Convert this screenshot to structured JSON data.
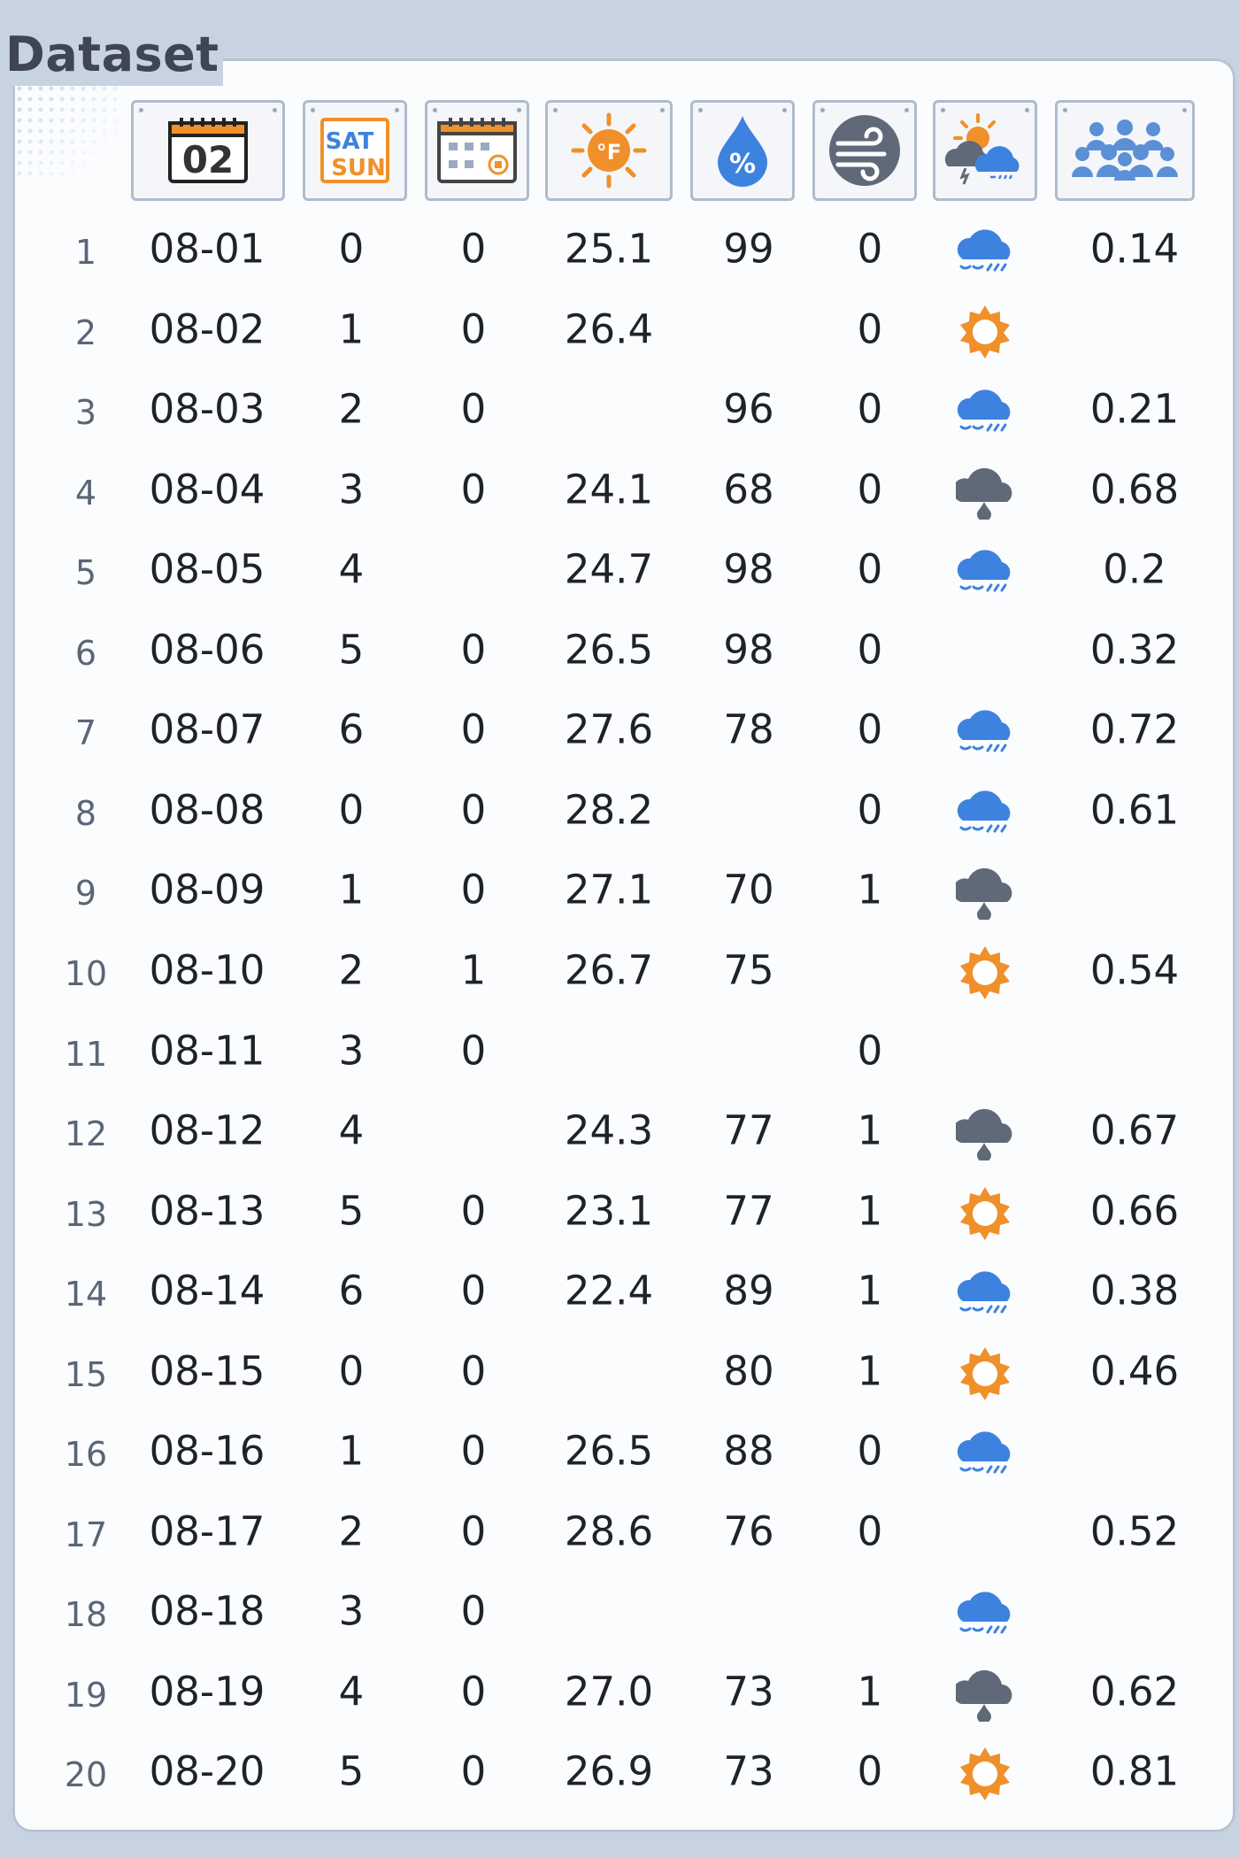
{
  "title": "Dataset",
  "columns": [
    {
      "key": "date",
      "icon": "calendar-date-icon",
      "icon_text": "02"
    },
    {
      "key": "weekday",
      "icon": "weekday-sat-sun-icon",
      "icon_text_1": "SAT",
      "icon_text_2": "SUN"
    },
    {
      "key": "holiday",
      "icon": "calendar-holiday-icon"
    },
    {
      "key": "temperature",
      "icon": "sun-thermometer-icon",
      "icon_text": "°F"
    },
    {
      "key": "humidity",
      "icon": "humidity-drop-icon",
      "icon_text": "%"
    },
    {
      "key": "windy",
      "icon": "wind-icon"
    },
    {
      "key": "weather",
      "icon": "weather-icon"
    },
    {
      "key": "crowd",
      "icon": "crowd-people-icon"
    }
  ],
  "colors": {
    "sunny": "#f0902a",
    "rain": "#3d82df",
    "storm": "#5f6978",
    "header_border": "#aebccd"
  },
  "rows": [
    {
      "n": "1",
      "date": "08-01",
      "weekday": "0",
      "holiday": "0",
      "temperature": "25.1",
      "humidity": "99",
      "windy": "0",
      "weather": "rain",
      "crowd": "0.14"
    },
    {
      "n": "2",
      "date": "08-02",
      "weekday": "1",
      "holiday": "0",
      "temperature": "26.4",
      "humidity": "",
      "windy": "0",
      "weather": "sunny",
      "crowd": ""
    },
    {
      "n": "3",
      "date": "08-03",
      "weekday": "2",
      "holiday": "0",
      "temperature": "",
      "humidity": "96",
      "windy": "0",
      "weather": "rain",
      "crowd": "0.21"
    },
    {
      "n": "4",
      "date": "08-04",
      "weekday": "3",
      "holiday": "0",
      "temperature": "24.1",
      "humidity": "68",
      "windy": "0",
      "weather": "storm",
      "crowd": "0.68"
    },
    {
      "n": "5",
      "date": "08-05",
      "weekday": "4",
      "holiday": "",
      "temperature": "24.7",
      "humidity": "98",
      "windy": "0",
      "weather": "rain",
      "crowd": "0.2"
    },
    {
      "n": "6",
      "date": "08-06",
      "weekday": "5",
      "holiday": "0",
      "temperature": "26.5",
      "humidity": "98",
      "windy": "0",
      "weather": "",
      "crowd": "0.32"
    },
    {
      "n": "7",
      "date": "08-07",
      "weekday": "6",
      "holiday": "0",
      "temperature": "27.6",
      "humidity": "78",
      "windy": "0",
      "weather": "rain",
      "crowd": "0.72"
    },
    {
      "n": "8",
      "date": "08-08",
      "weekday": "0",
      "holiday": "0",
      "temperature": "28.2",
      "humidity": "",
      "windy": "0",
      "weather": "rain",
      "crowd": "0.61"
    },
    {
      "n": "9",
      "date": "08-09",
      "weekday": "1",
      "holiday": "0",
      "temperature": "27.1",
      "humidity": "70",
      "windy": "1",
      "weather": "storm",
      "crowd": ""
    },
    {
      "n": "10",
      "date": "08-10",
      "weekday": "2",
      "holiday": "1",
      "temperature": "26.7",
      "humidity": "75",
      "windy": "",
      "weather": "sunny",
      "crowd": "0.54"
    },
    {
      "n": "11",
      "date": "08-11",
      "weekday": "3",
      "holiday": "0",
      "temperature": "",
      "humidity": "",
      "windy": "0",
      "weather": "",
      "crowd": ""
    },
    {
      "n": "12",
      "date": "08-12",
      "weekday": "4",
      "holiday": "",
      "temperature": "24.3",
      "humidity": "77",
      "windy": "1",
      "weather": "storm",
      "crowd": "0.67"
    },
    {
      "n": "13",
      "date": "08-13",
      "weekday": "5",
      "holiday": "0",
      "temperature": "23.1",
      "humidity": "77",
      "windy": "1",
      "weather": "sunny",
      "crowd": "0.66"
    },
    {
      "n": "14",
      "date": "08-14",
      "weekday": "6",
      "holiday": "0",
      "temperature": "22.4",
      "humidity": "89",
      "windy": "1",
      "weather": "rain",
      "crowd": "0.38"
    },
    {
      "n": "15",
      "date": "08-15",
      "weekday": "0",
      "holiday": "0",
      "temperature": "",
      "humidity": "80",
      "windy": "1",
      "weather": "sunny",
      "crowd": "0.46"
    },
    {
      "n": "16",
      "date": "08-16",
      "weekday": "1",
      "holiday": "0",
      "temperature": "26.5",
      "humidity": "88",
      "windy": "0",
      "weather": "rain",
      "crowd": ""
    },
    {
      "n": "17",
      "date": "08-17",
      "weekday": "2",
      "holiday": "0",
      "temperature": "28.6",
      "humidity": "76",
      "windy": "0",
      "weather": "",
      "crowd": "0.52"
    },
    {
      "n": "18",
      "date": "08-18",
      "weekday": "3",
      "holiday": "0",
      "temperature": "",
      "humidity": "",
      "windy": "",
      "weather": "rain",
      "crowd": ""
    },
    {
      "n": "19",
      "date": "08-19",
      "weekday": "4",
      "holiday": "0",
      "temperature": "27.0",
      "humidity": "73",
      "windy": "1",
      "weather": "storm",
      "crowd": "0.62"
    },
    {
      "n": "20",
      "date": "08-20",
      "weekday": "5",
      "holiday": "0",
      "temperature": "26.9",
      "humidity": "73",
      "windy": "0",
      "weather": "sunny",
      "crowd": "0.81"
    }
  ]
}
